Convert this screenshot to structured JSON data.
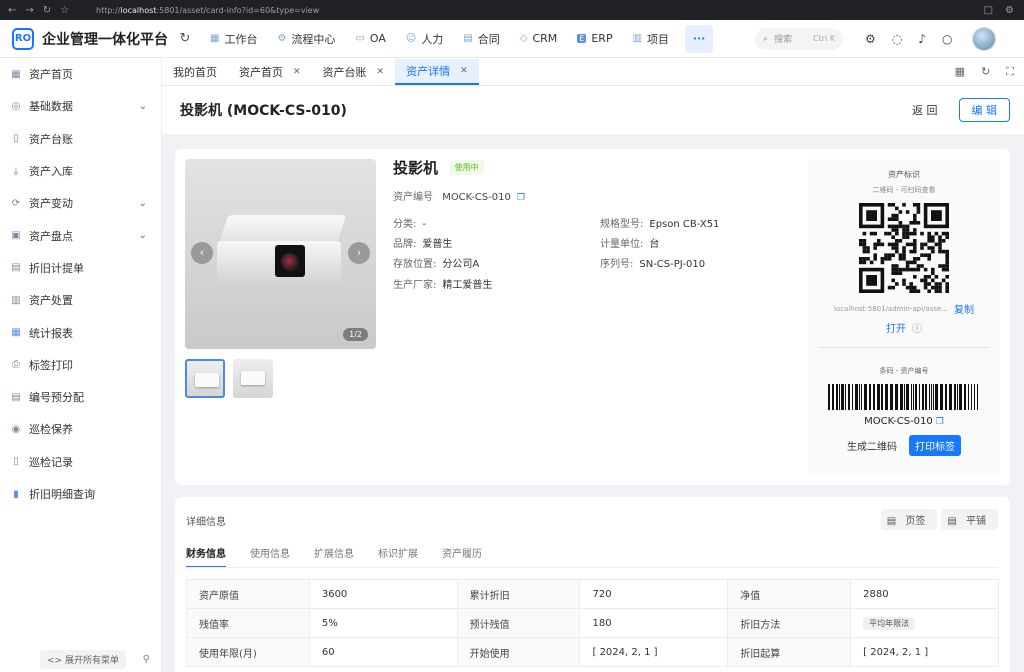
{
  "browser": {
    "url_prefix": "http://",
    "url_host": "localhost",
    "url_rest": ":5801/asset/card-info?id=60&type=view"
  },
  "header": {
    "logo_text": "RO",
    "app_title": "企业管理一体化平台",
    "nav": [
      {
        "label": "工作台",
        "icon": "workbench-icon"
      },
      {
        "label": "流程中心",
        "icon": "flow-icon"
      },
      {
        "label": "OA",
        "icon": "oa-icon"
      },
      {
        "label": "人力",
        "icon": "people-icon"
      },
      {
        "label": "合同",
        "icon": "contract-icon"
      },
      {
        "label": "CRM",
        "icon": "crm-icon"
      },
      {
        "label": "ERP",
        "icon": "erp-icon"
      },
      {
        "label": "项目",
        "icon": "project-icon"
      }
    ],
    "more_label": "···",
    "search_placeholder": "搜索",
    "search_shortcut": "Ctrl K"
  },
  "sidebar": {
    "items": [
      {
        "label": "资产首页",
        "has_children": false
      },
      {
        "label": "基础数据",
        "has_children": true
      },
      {
        "label": "资产台账",
        "has_children": false
      },
      {
        "label": "资产入库",
        "has_children": false
      },
      {
        "label": "资产变动",
        "has_children": true
      },
      {
        "label": "资产盘点",
        "has_children": true
      },
      {
        "label": "折旧计提单",
        "has_children": false
      },
      {
        "label": "资产处置",
        "has_children": false
      },
      {
        "label": "统计报表",
        "has_children": false
      },
      {
        "label": "标签打印",
        "has_children": false
      },
      {
        "label": "编号预分配",
        "has_children": false
      },
      {
        "label": "巡检保养",
        "has_children": false
      },
      {
        "label": "巡检记录",
        "has_children": false
      },
      {
        "label": "折旧明细查询",
        "has_children": false
      }
    ],
    "expand_all": "展开所有菜单"
  },
  "tabs": [
    {
      "label": "我的首页",
      "closable": false,
      "active": false
    },
    {
      "label": "资产首页",
      "closable": true,
      "active": false
    },
    {
      "label": "资产台账",
      "closable": true,
      "active": false
    },
    {
      "label": "资产详情",
      "closable": true,
      "active": true
    }
  ],
  "page": {
    "title": "投影机 (MOCK-CS-010)",
    "back_label": "返 回",
    "edit_label": "编 辑"
  },
  "asset": {
    "name": "投影机",
    "status": "使用中",
    "code_label": "资产编号",
    "code": "MOCK-CS-010",
    "image_counter": "1/2",
    "fields_left": [
      {
        "label": "分类:",
        "value": "-"
      },
      {
        "label": "品牌:",
        "value": "爱普生"
      },
      {
        "label": "存放位置:",
        "value": "分公司A"
      },
      {
        "label": "生产厂家:",
        "value": "精工爱普生"
      }
    ],
    "fields_right": [
      {
        "label": "规格型号:",
        "value": "Epson CB-X51"
      },
      {
        "label": "计量单位:",
        "value": "台"
      },
      {
        "label": "序列号:",
        "value": "SN-CS-PJ-010"
      }
    ]
  },
  "identity": {
    "title": "资产标识",
    "subtitle": "二维码 - 可扫码查看",
    "link_text": "localhost:5801/admin-api/asse...",
    "copy_label": "复制",
    "open_label": "打开",
    "barcode_title": "条码 - 资产编号",
    "barcode_value": "MOCK-CS-010",
    "generate_label": "生成二维码",
    "print_label": "打印标签"
  },
  "detail": {
    "title": "详细信息",
    "view_tabs": "页签",
    "view_flat": "平铺",
    "tabs": [
      "财务信息",
      "使用信息",
      "扩展信息",
      "标识扩展",
      "资产履历"
    ],
    "rows": [
      [
        {
          "k": "资产原值",
          "v": "3600"
        },
        {
          "k": "累计折旧",
          "v": "720"
        },
        {
          "k": "净值",
          "v": "2880"
        }
      ],
      [
        {
          "k": "残值率",
          "v": "5%"
        },
        {
          "k": "预计残值",
          "v": "180"
        },
        {
          "k": "折旧方法",
          "v": "平均年限法"
        }
      ],
      [
        {
          "k": "使用年限(月)",
          "v": "60"
        },
        {
          "k": "开始使用",
          "v": "[ 2024, 2, 1 ]"
        },
        {
          "k": "折旧起算",
          "v": "[ 2024, 2, 1 ]"
        }
      ]
    ]
  },
  "colors": {
    "accent": "#1677ff",
    "status_green": "#52c41a"
  }
}
